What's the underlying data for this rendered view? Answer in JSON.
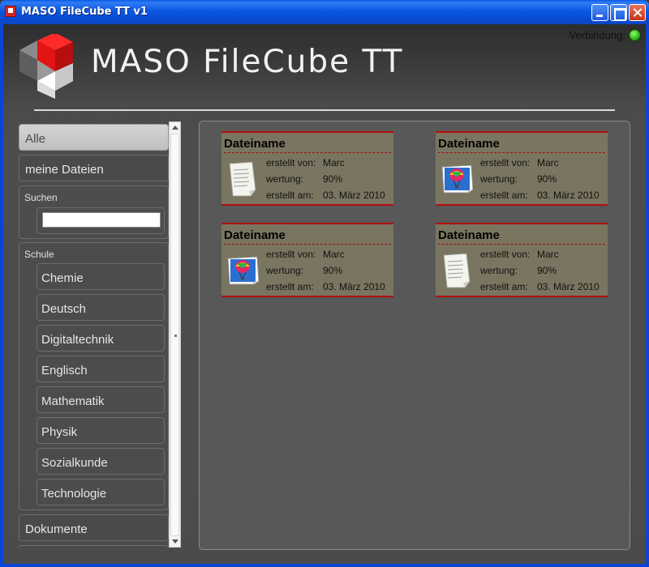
{
  "window": {
    "title": "MASO FileCube TT v1"
  },
  "header": {
    "brand": "MASO FileCube TT",
    "status_label": "Verbindung:",
    "status_color": "#3cc42a"
  },
  "sidebar": {
    "top_items": [
      "Alle",
      "meine Dateien"
    ],
    "search": {
      "label": "Suchen",
      "value": "",
      "placeholder": ""
    },
    "school": {
      "label": "Schule",
      "subjects": [
        "Chemie",
        "Deutsch",
        "Digitaltechnik",
        "Englisch",
        "Mathematik",
        "Physik",
        "Sozialkunde",
        "Technologie"
      ]
    },
    "bottom_items": [
      "Dokumente"
    ]
  },
  "files": [
    {
      "name": "Dateiname",
      "thumb": "document-icon",
      "created_by_label": "erstellt von:",
      "created_by": "Marc",
      "rating_label": "wertung:",
      "rating": "90%",
      "created_on_label": "erstellt am:",
      "created_on": "03. März 2010"
    },
    {
      "name": "Dateiname",
      "thumb": "image-icon",
      "created_by_label": "erstellt von:",
      "created_by": "Marc",
      "rating_label": "wertung:",
      "rating": "90%",
      "created_on_label": "erstellt am:",
      "created_on": "03. März 2010"
    },
    {
      "name": "Dateiname",
      "thumb": "image-icon",
      "created_by_label": "erstellt von:",
      "created_by": "Marc",
      "rating_label": "wertung:",
      "rating": "90%",
      "created_on_label": "erstellt am:",
      "created_on": "03. März 2010"
    },
    {
      "name": "Dateiname",
      "thumb": "document-icon",
      "created_by_label": "erstellt von:",
      "created_by": "Marc",
      "rating_label": "wertung:",
      "rating": "90%",
      "created_on_label": "erstellt am:",
      "created_on": "03. März 2010"
    }
  ]
}
